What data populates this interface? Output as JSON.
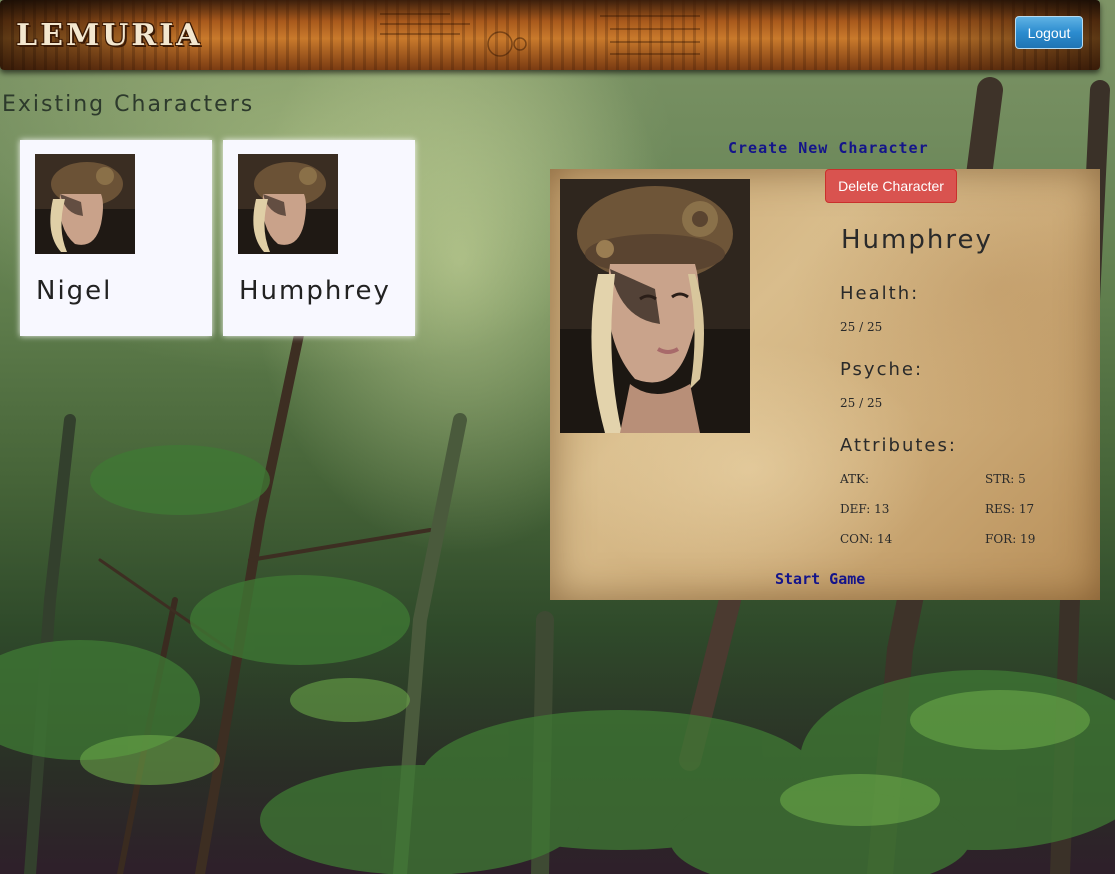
{
  "header": {
    "logo": "LEMURIA",
    "logout_label": "Logout"
  },
  "existing": {
    "title": "Existing Characters",
    "characters": [
      {
        "name": "Nigel"
      },
      {
        "name": "Humphrey"
      }
    ]
  },
  "create_label": "Create New Character",
  "detail": {
    "delete_label": "Delete Character",
    "name": "Humphrey",
    "health_label": "Health:",
    "health_value": "25 / 25",
    "psyche_label": "Psyche:",
    "psyche_value": "25 / 25",
    "attributes_label": "Attributes:",
    "attributes": {
      "atk": "ATK:",
      "str": "STR: 5",
      "def": "DEF: 13",
      "res": "RES: 17",
      "con": "CON: 14",
      "for": "FOR: 19"
    },
    "start_label": "Start Game"
  },
  "colors": {
    "logout": "#2c8ccf",
    "delete": "#d9534f",
    "link": "#14148a",
    "card": "#f8f8ff"
  }
}
